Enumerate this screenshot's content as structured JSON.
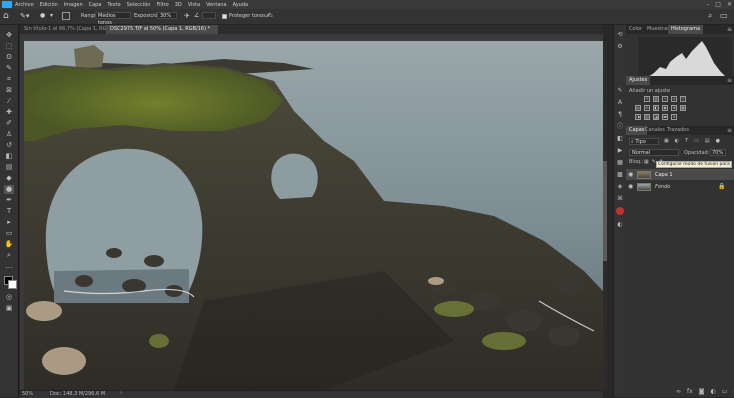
{
  "menubar": {
    "items": [
      "Archivo",
      "Edición",
      "Imagen",
      "Capa",
      "Texto",
      "Selección",
      "Filtro",
      "3D",
      "Vista",
      "Ventana",
      "Ayuda"
    ],
    "window_controls": [
      "–",
      "□",
      "✕"
    ]
  },
  "options": {
    "rango_label": "Rango:",
    "rango_value": "Medios tonos",
    "exposicion_label": "Exposición:",
    "exposicion_value": "30%",
    "proteger_tonos": "Proteger tonos"
  },
  "tabs": [
    "Sin título-1 al 66,7% (Capa 1, RGB/8#) *",
    "DSC2975.TIF al 50% (Capa 1, RGB/16) *"
  ],
  "ruler_ticks": [
    "0",
    "2",
    "4",
    "6",
    "8",
    "10",
    "12",
    "14",
    "16",
    "18",
    "20",
    "22",
    "24",
    "26",
    "28",
    "30",
    "32",
    "34",
    "36",
    "38",
    "40",
    "42",
    "44",
    "46"
  ],
  "status": {
    "zoom": "50%",
    "doc": "Doc: 148,3 M/296,6 M"
  },
  "panels": {
    "top_tabs": [
      "Color",
      "Muestras",
      "Histograma"
    ],
    "ajustes_title": "Ajustes",
    "ajustes_subtitle": "Añadir un ajuste",
    "layers_tabs": [
      "Capas",
      "Canales",
      "Trazados"
    ],
    "filter_label": "Tipo",
    "blend_mode": "Normal",
    "opacity_label": "Opacidad:",
    "opacity_value": "70%",
    "lock_label": "Bloq.:",
    "fill_label": "Relleno:",
    "fill_value": "100%",
    "tooltip": "Configurar modo de fusión para capa",
    "layers": [
      {
        "name": "Capa 1",
        "selected": true
      },
      {
        "name": "Fondo",
        "selected": false
      }
    ]
  },
  "colors": {
    "accent": "#31a8ff",
    "panel_bg": "#323232",
    "app_bg": "#282828"
  }
}
